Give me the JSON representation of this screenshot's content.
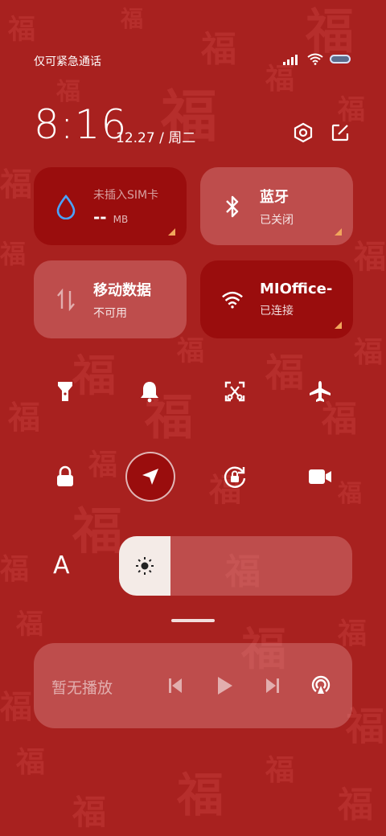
{
  "status_bar": {
    "carrier_text": "仅可紧急通话",
    "icons": [
      "signal-icon",
      "wifi-icon",
      "battery-icon"
    ]
  },
  "header": {
    "time": "8:16",
    "date": "12.27 / 周二",
    "icons": [
      "settings-icon",
      "edit-icon"
    ]
  },
  "tiles": [
    {
      "icon": "water-drop-icon",
      "title": "未插入SIM卡",
      "value": "--",
      "unit": "MB",
      "state": "active"
    },
    {
      "icon": "bluetooth-icon",
      "title": "蓝牙",
      "subtitle": "已关闭",
      "state": "inactive"
    },
    {
      "icon": "mobile-data-icon",
      "title": "移动数据",
      "subtitle": "不可用",
      "state": "inactive"
    },
    {
      "icon": "wifi-icon",
      "title": "MIOffice-",
      "subtitle": "已连接",
      "state": "active"
    }
  ],
  "toggles_row1": [
    "flashlight-icon",
    "bell-icon",
    "screenshot-icon",
    "airplane-icon"
  ],
  "toggles_row2": [
    "lock-icon",
    "location-icon",
    "rotation-lock-icon",
    "video-camera-icon"
  ],
  "brightness": {
    "label": "A",
    "level": 0.22,
    "icon": "sun-icon"
  },
  "media": {
    "status": "暂无播放",
    "controls": [
      "previous-icon",
      "play-icon",
      "next-icon",
      "cast-icon"
    ]
  },
  "colors": {
    "background": "#a8211f",
    "tile_active": "#9a0d0d",
    "tile_inactive": "rgba(225,150,150,0.38)",
    "corner_accent": "#f1a65c",
    "wifi_accent": "#4aa3ff"
  }
}
